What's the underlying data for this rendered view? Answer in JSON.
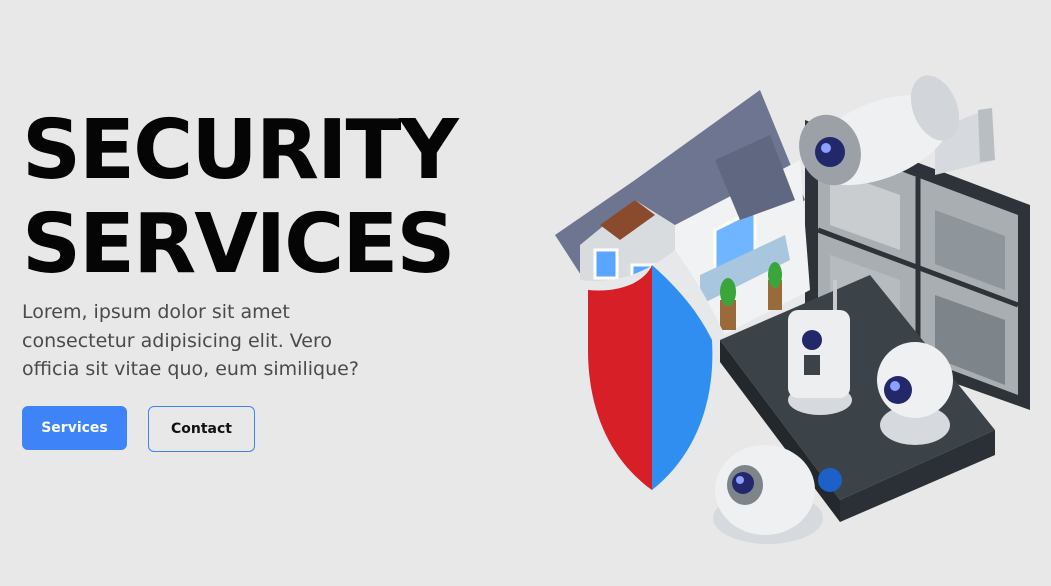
{
  "hero": {
    "title_line1": "SECURITY",
    "title_line2": "SERVICES",
    "subtitle": "Lorem, ipsum dolor sit amet consectetur adipisicing elit. Vero officia sit vitae quo, eum similique?",
    "primary_button": "Services",
    "secondary_button": "Contact"
  },
  "illustration": {
    "icon": "security-system-illustration",
    "shield_colors": [
      "#d61f26",
      "#2f8ef0"
    ],
    "accent": "#3f83f8"
  }
}
